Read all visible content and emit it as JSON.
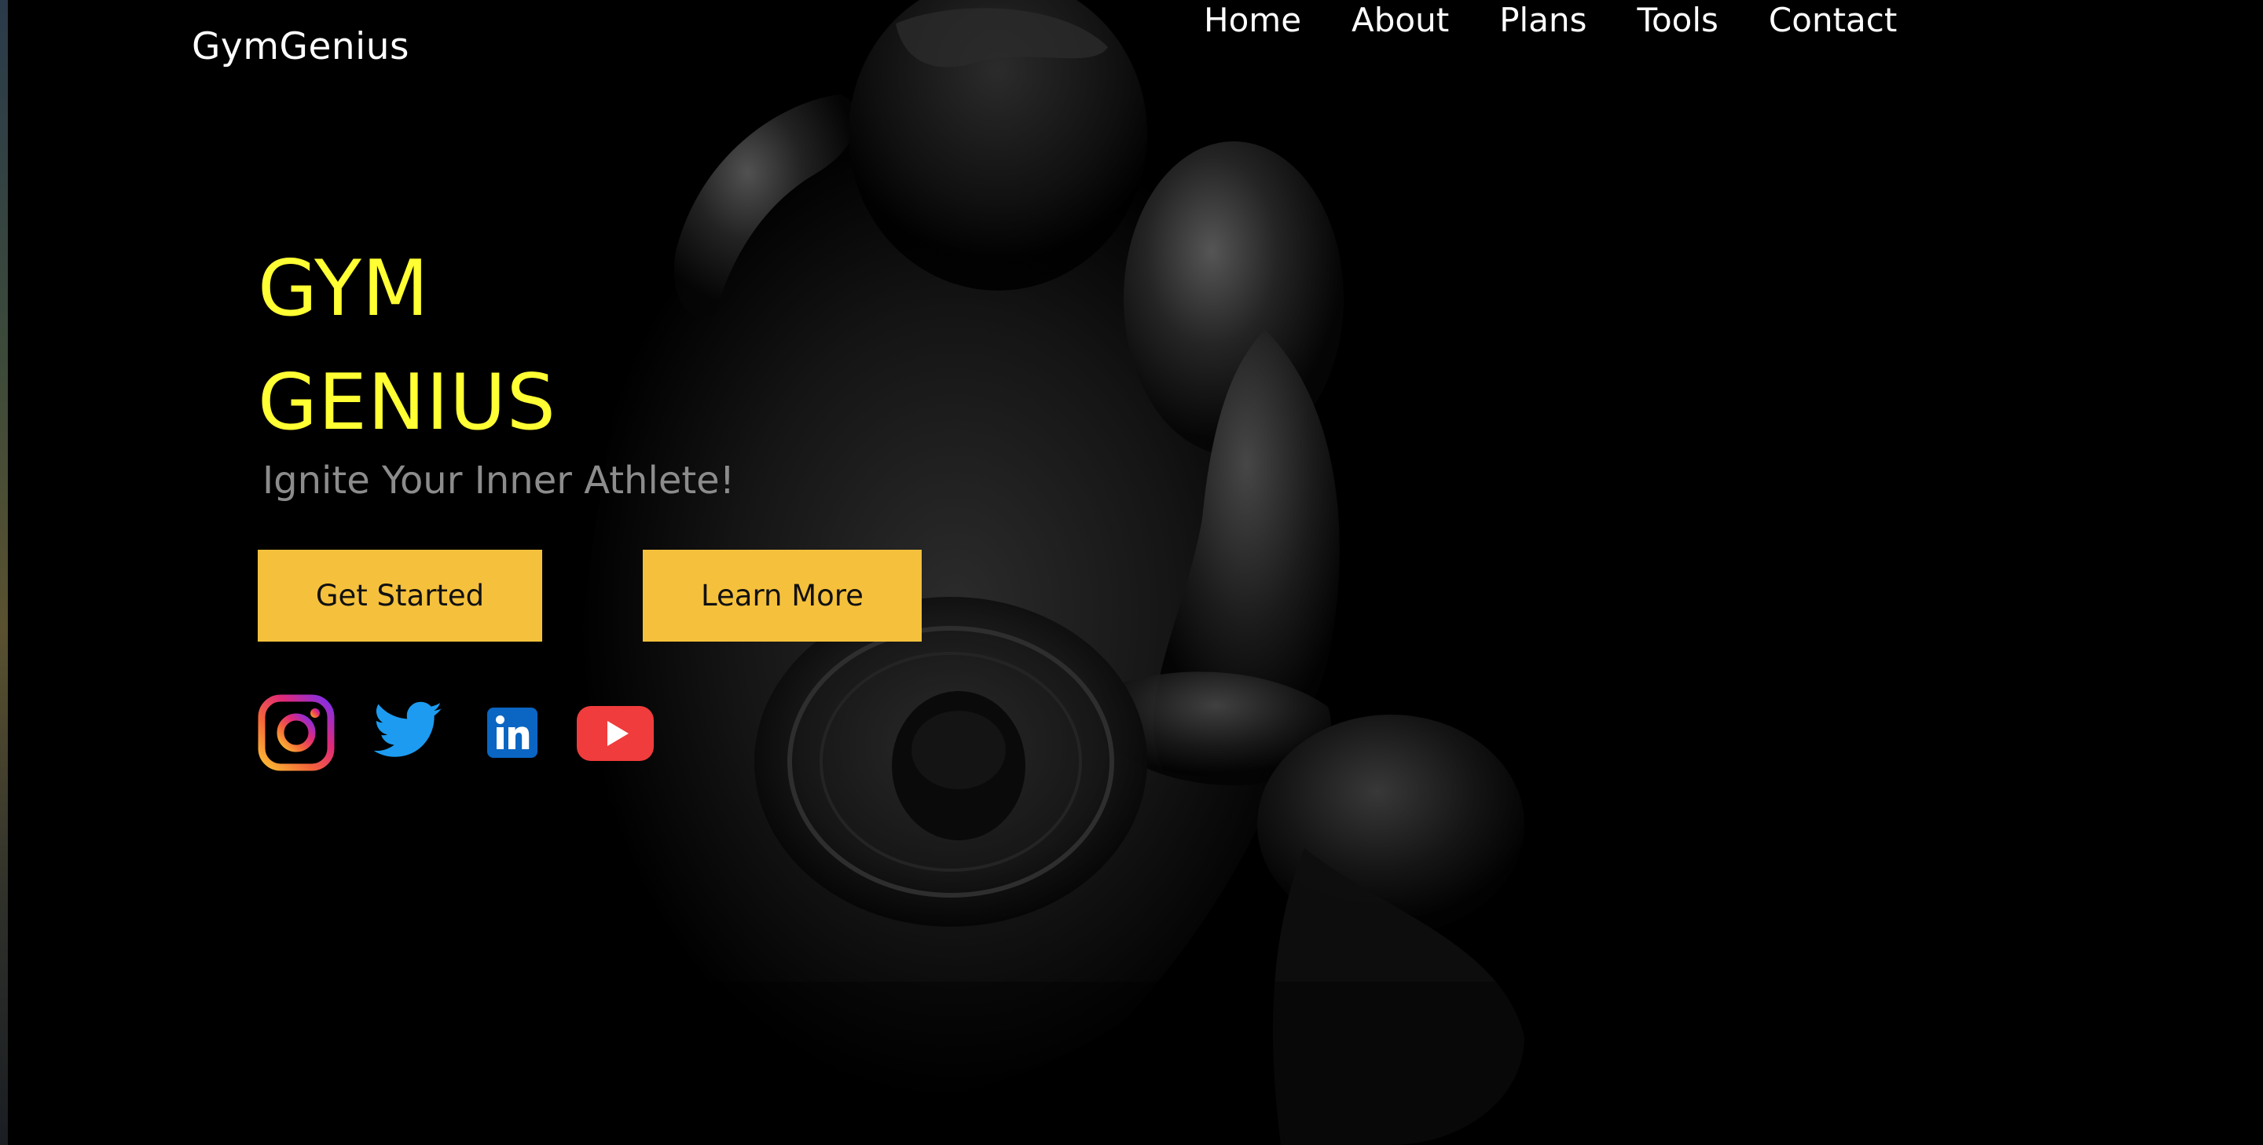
{
  "header": {
    "logo_text": "GymGenius",
    "nav": [
      {
        "label": "Home"
      },
      {
        "label": "About"
      },
      {
        "label": "Plans"
      },
      {
        "label": "Tools"
      },
      {
        "label": "Contact"
      }
    ]
  },
  "hero": {
    "title_line1": "GYM",
    "title_line2": "GENIUS",
    "tagline": "Ignite Your Inner Athlete!",
    "primary_button": "Get Started",
    "secondary_button": "Learn More"
  },
  "socials": [
    {
      "icon": "instagram-icon"
    },
    {
      "icon": "twitter-icon"
    },
    {
      "icon": "linkedin-icon"
    },
    {
      "icon": "youtube-icon"
    }
  ],
  "colors": {
    "background": "#000000",
    "title": "#ffff33",
    "button": "#f5c13c",
    "tagline": "#8c8c8c"
  }
}
